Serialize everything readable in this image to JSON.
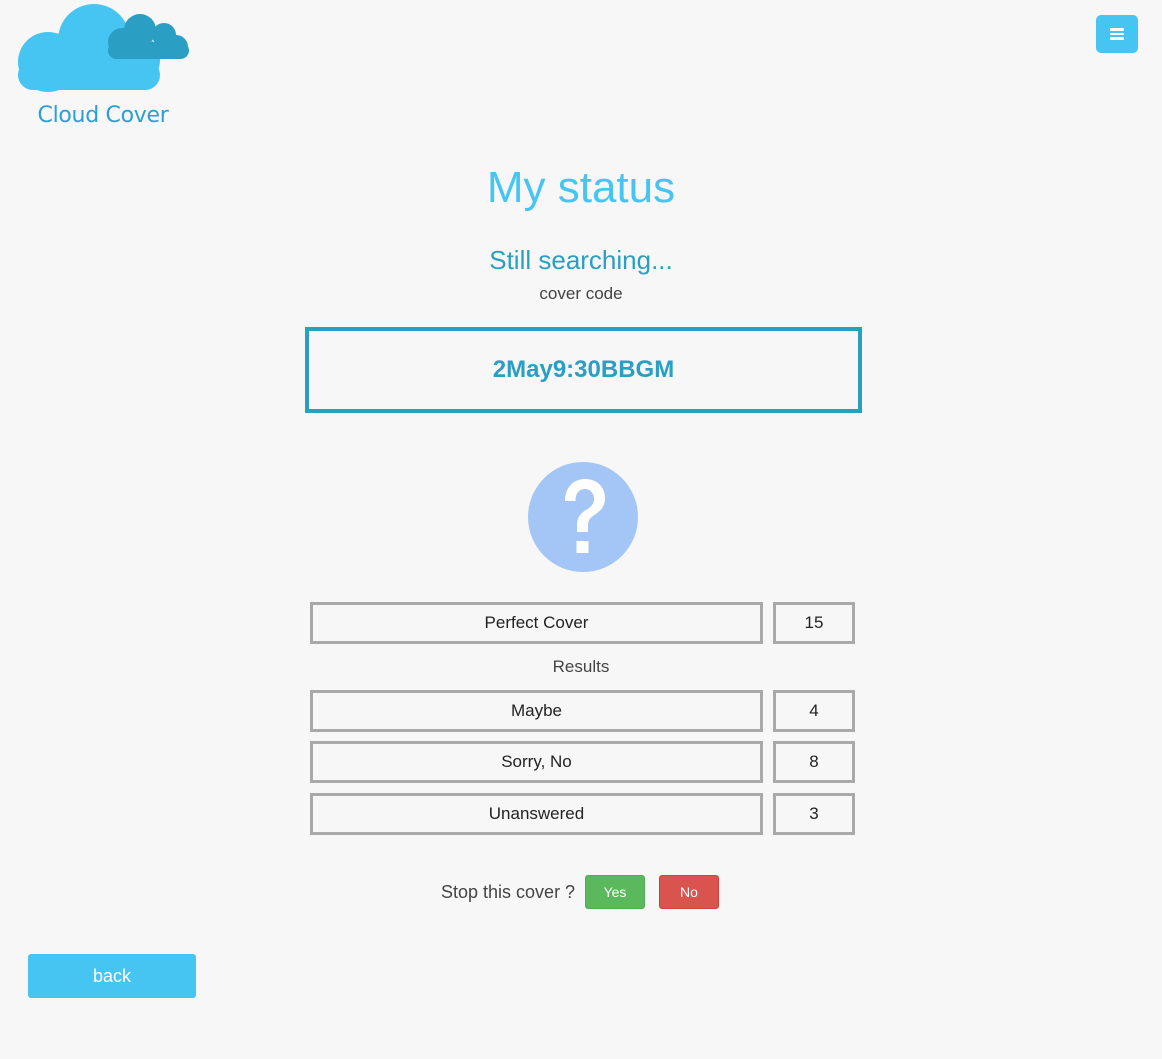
{
  "app": {
    "logo_text": "Cloud Cover",
    "logo_icon": "cloud-icon",
    "menu_icon": "hamburger-menu-icon"
  },
  "colors": {
    "accent": "#46c5f2",
    "accent_dark": "#2a9fc3",
    "success": "#5cb85c",
    "danger": "#d9534f",
    "status_icon": "#a4c6f7"
  },
  "page": {
    "title": "My status",
    "status_text": "Still searching...",
    "code_label": "cover code",
    "code_value": "2May9:30BBGM",
    "status_icon": "question-mark-icon"
  },
  "results": {
    "perfect": {
      "label": "Perfect Cover",
      "value": "15"
    },
    "section_label": "Results",
    "rows": [
      {
        "label": "Maybe",
        "value": "4"
      },
      {
        "label": "Sorry, No",
        "value": "8"
      },
      {
        "label": "Unanswered",
        "value": "3"
      }
    ]
  },
  "stop": {
    "question": "Stop this cover ?",
    "yes_label": "Yes",
    "no_label": "No"
  },
  "nav": {
    "back_label": "back"
  }
}
